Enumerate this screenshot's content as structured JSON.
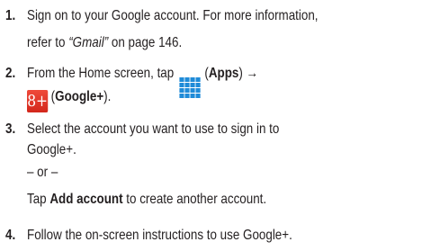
{
  "steps": [
    {
      "number": "1.",
      "line1": "Sign on to your Google account. For more information,",
      "line2_pre": "refer to ",
      "line2_ref": "“Gmail”",
      "line2_post": " on page 146."
    },
    {
      "number": "2.",
      "line1_pre": "From the Home screen, tap",
      "apps_icon": "apps-grid-icon",
      "line1_paren_open": " (",
      "line1_bold": "Apps",
      "line1_post": ") →",
      "gplus_icon": "google-plus-icon",
      "gplus_glyph": "8+",
      "line2_paren_open": "(",
      "line2_bold": "Google+",
      "line2_post": ")."
    },
    {
      "number": "3.",
      "line1": "Select the account you want to use to sign in to",
      "line2": "Google+.",
      "or_text": "– or –",
      "alt_pre": "Tap ",
      "alt_bold": "Add account",
      "alt_post": " to create another account."
    },
    {
      "number": "4.",
      "line1": "Follow the on-screen instructions to use Google+."
    }
  ],
  "colors": {
    "apps_icon": "#1f8bd8",
    "gplus_icon": "#e03a2c"
  }
}
